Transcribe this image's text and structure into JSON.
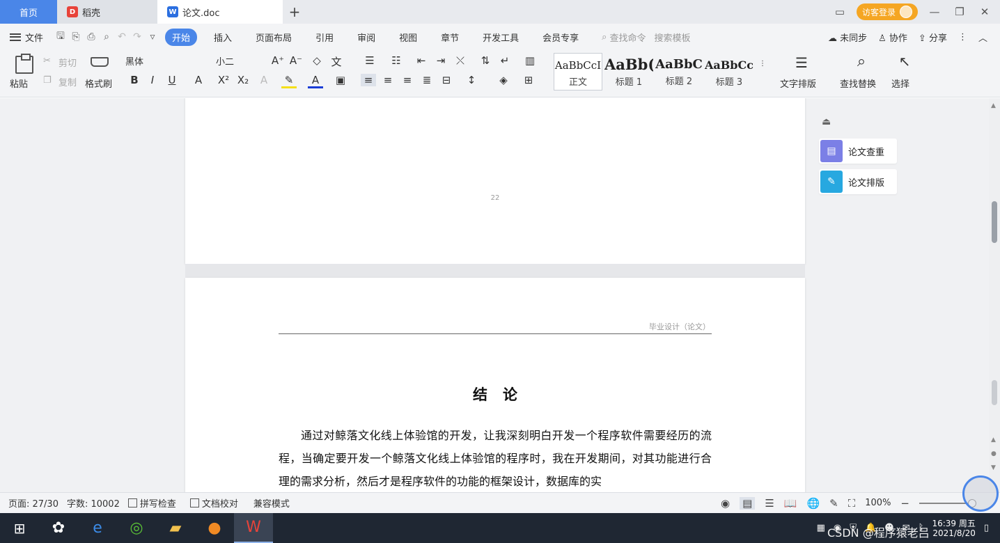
{
  "tabs": {
    "home": "首页",
    "docer": "稻壳",
    "doc": "论文.doc",
    "add": "+"
  },
  "titlebar": {
    "login": "访客登录"
  },
  "menu": {
    "file": "文件",
    "tabs": [
      "开始",
      "插入",
      "页面布局",
      "引用",
      "审阅",
      "视图",
      "章节",
      "开发工具",
      "会员专享"
    ],
    "active_index": 0,
    "search": "查找命令",
    "search_template": "搜索模板",
    "sync": "未同步",
    "collab": "协作",
    "share": "分享"
  },
  "ribbon": {
    "paste": "粘贴",
    "cut": "剪切",
    "copy": "复制",
    "format_painter": "格式刷",
    "font_name": "黑体",
    "font_size": "小二",
    "styles": [
      {
        "sample": "AaBbCcI",
        "name": "正文"
      },
      {
        "sample": "AaBb(",
        "name": "标题 1"
      },
      {
        "sample": "AaBbC",
        "name": "标题 2"
      },
      {
        "sample": "AaBbCcl",
        "name": "标题 3"
      }
    ],
    "text_layout": "文字排版",
    "find_replace": "查找替换",
    "select": "选择"
  },
  "document": {
    "page_number": "22",
    "header": "毕业设计（论文）",
    "title": "结论",
    "body": "通过对鲸落文化线上体验馆的开发，让我深刻明白开发一个程序软件需要经历的流程，当确定要开发一个鲸落文化线上体验馆的程序时，我在开发期间，对其功能进行合理的需求分析，然后才是程序软件的功能的框架设计，数据库的实"
  },
  "side_panel": {
    "check": "论文查重",
    "layout": "论文排版"
  },
  "status": {
    "page": "页面: 27/30",
    "words": "字数: 10002",
    "spell": "拼写检查",
    "proof": "文档校对",
    "compat": "兼容模式",
    "zoom": "100%"
  },
  "taskbar": {
    "time": "16:39 周五",
    "date": "2021/8/20",
    "watermark": "CSDN @程序猿老吕"
  }
}
